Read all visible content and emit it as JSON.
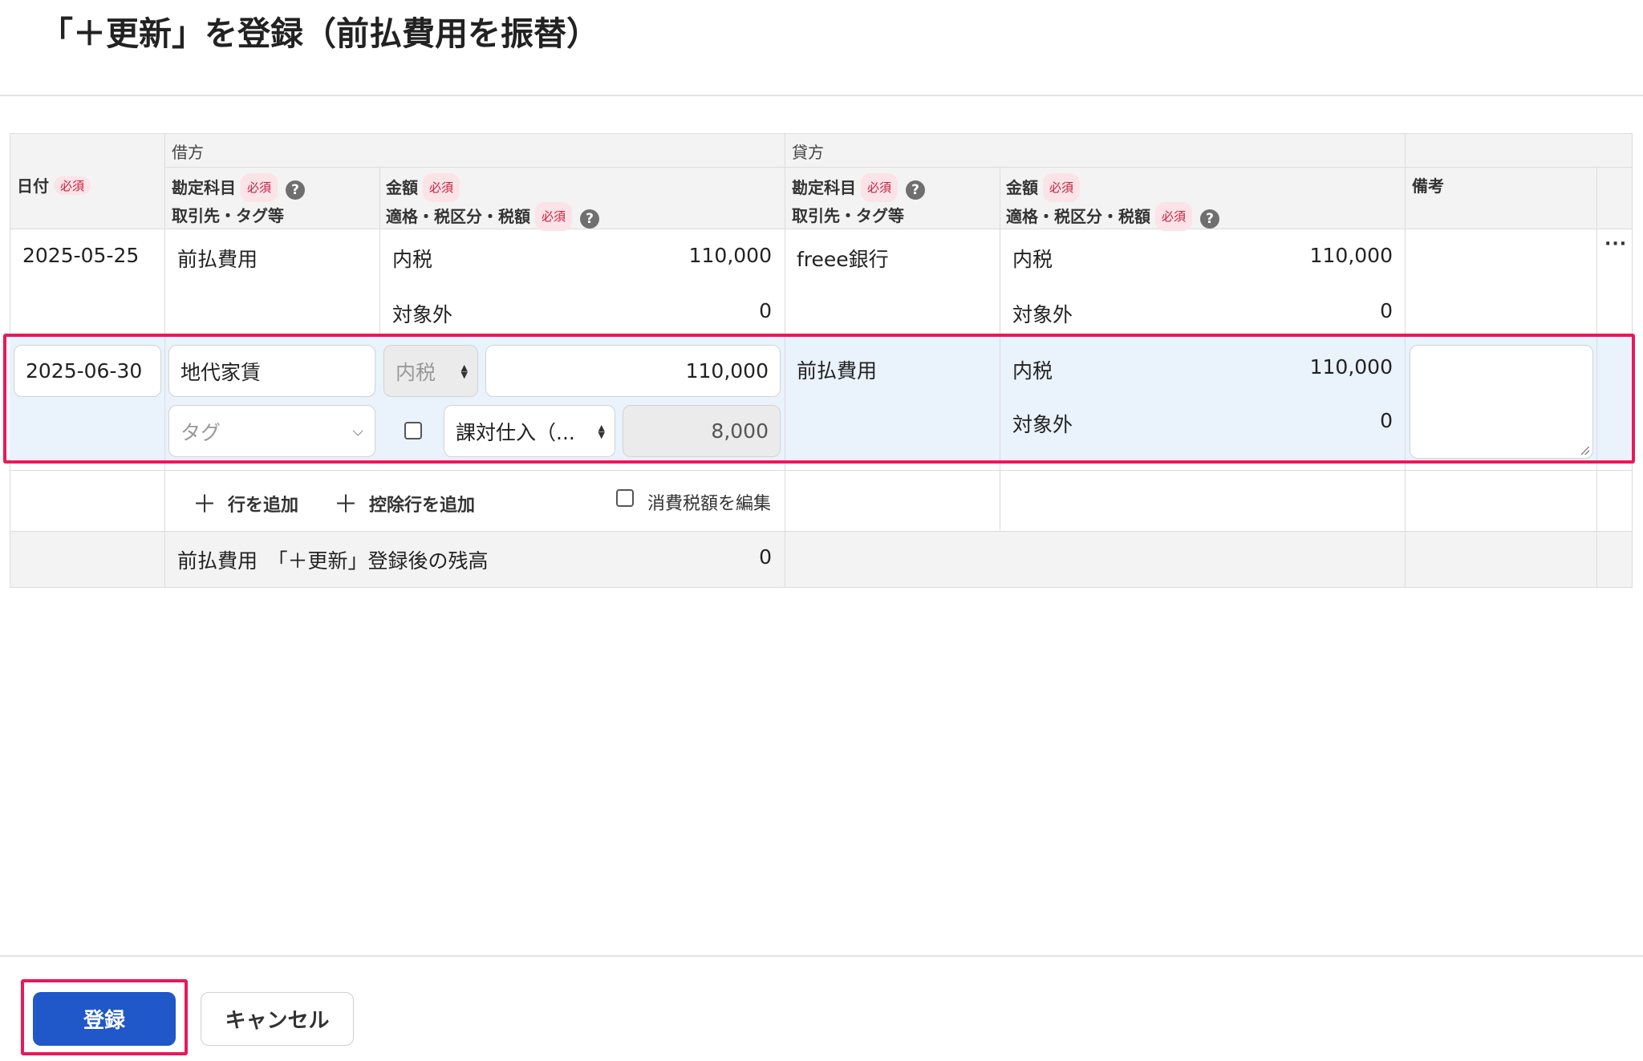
{
  "title": "「＋更新」を登録（前払費用を振替）",
  "groups": {
    "debit": "借方",
    "credit": "貸方"
  },
  "headers": {
    "date": "日付",
    "required": "必須",
    "account": "勘定科目",
    "partner_tags": "取引先・タグ等",
    "amount": "金額",
    "tax_line": "適格・税区分・税額",
    "memo": "備考",
    "help": "?"
  },
  "existing_row": {
    "date": "2025-05-25",
    "debit_account": "前払費用",
    "debit_tax_1": "内税",
    "debit_amount_1": "110,000",
    "debit_tax_2": "対象外",
    "debit_amount_2": "0",
    "credit_account": "freee銀行",
    "credit_tax_1": "内税",
    "credit_amount_1": "110,000",
    "credit_tax_2": "対象外",
    "credit_amount_2": "0",
    "more": "···"
  },
  "new_row": {
    "date": "2025-06-30",
    "debit_account": "地代家賃",
    "tax_mode": "内税",
    "amount": "110,000",
    "tag_placeholder": "タグ",
    "tax_category": "課対仕入（...",
    "tax_amount": "8,000",
    "credit_account": "前払費用",
    "credit_tax_1": "内税",
    "credit_amount_1": "110,000",
    "credit_tax_2": "対象外",
    "credit_amount_2": "0"
  },
  "actions": {
    "add_row": "行を追加",
    "add_deduction_row": "控除行を追加",
    "edit_tax": "消費税額を編集"
  },
  "balance_row": {
    "label": "前払費用　「＋更新」登録後の残高",
    "value": "0"
  },
  "footer": {
    "submit": "登録",
    "cancel": "キャンセル"
  },
  "colors": {
    "highlight": "#e8185b",
    "primary": "#2057c9",
    "selected_row": "#eaf2fc",
    "required_badge": "#c81e3c"
  }
}
